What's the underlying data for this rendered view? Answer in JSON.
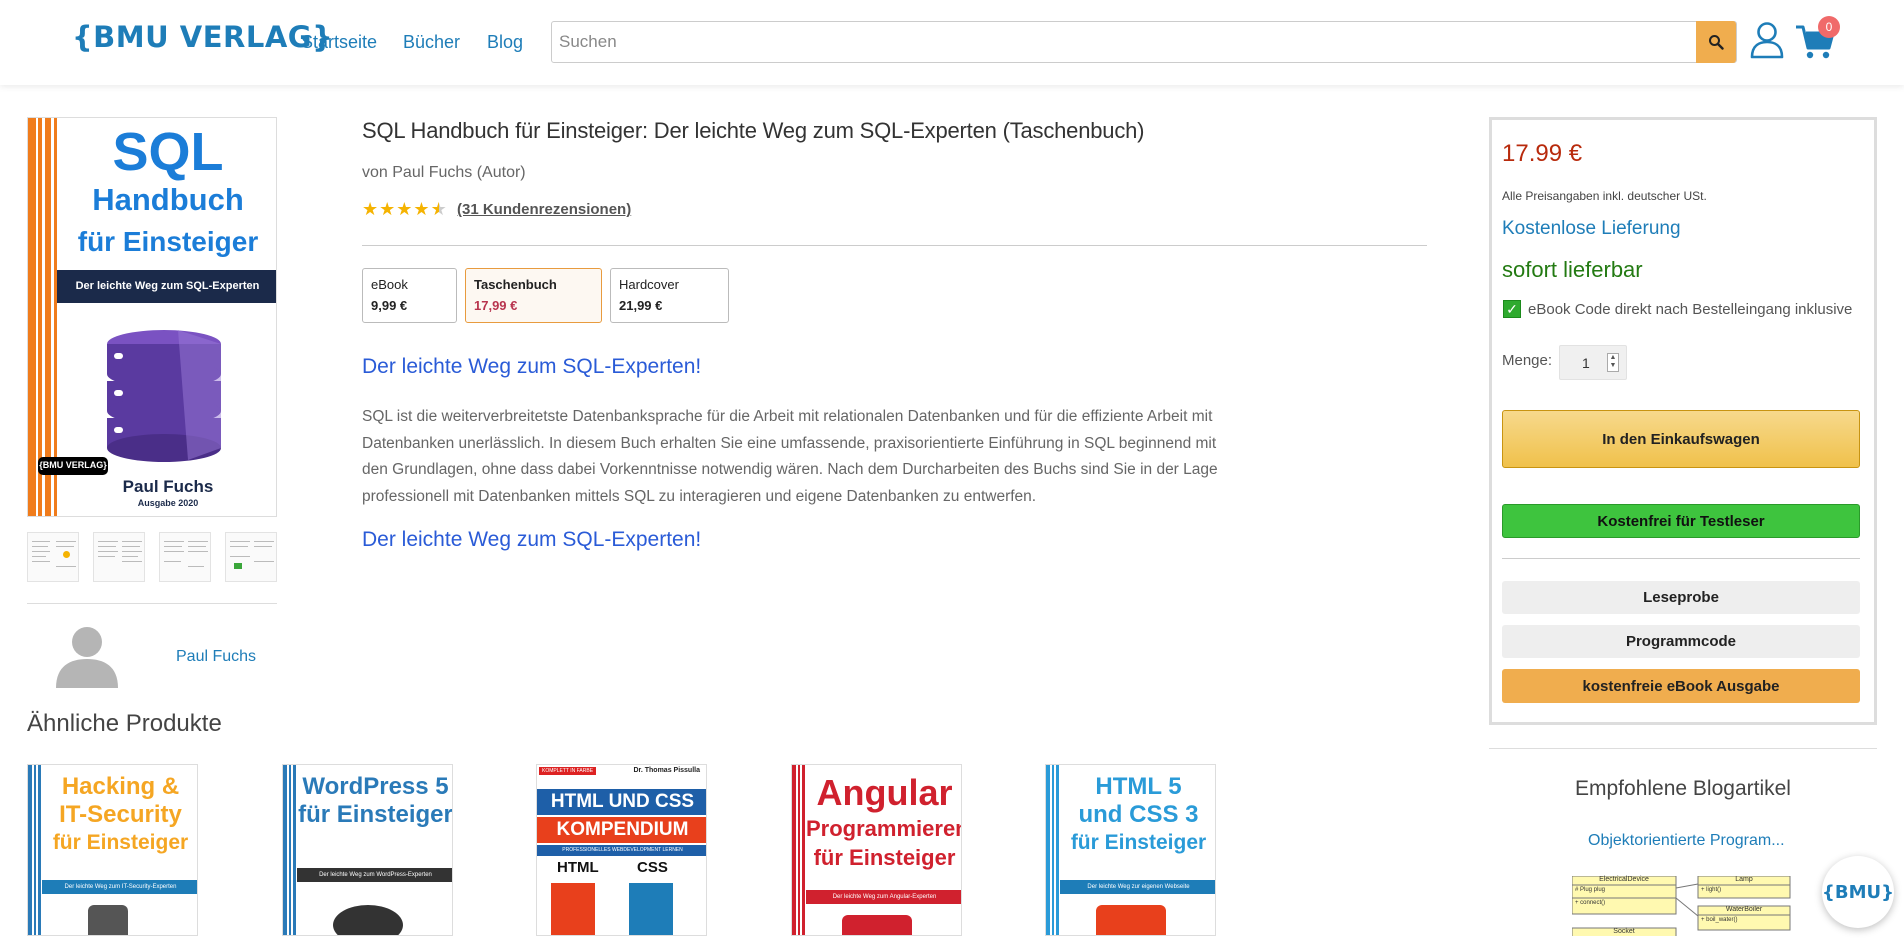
{
  "header": {
    "logo": "{BMU VERLAG}",
    "nav": [
      "Startseite",
      "Bücher",
      "Blog"
    ],
    "search_placeholder": "Suchen",
    "cart_count": "0"
  },
  "cover": {
    "title1": "SQL",
    "title2": "Handbuch",
    "title3": "für Einsteiger",
    "band": "Der leichte Weg zum SQL-Experten",
    "publisher": "{BMU VERLAG}",
    "author": "Paul Fuchs",
    "edition": "Ausgabe 2020"
  },
  "product": {
    "title": "SQL Handbuch für Einsteiger: Der leichte Weg zum SQL-Experten (Taschenbuch)",
    "byline": "von Paul Fuchs (Autor)",
    "rating": 4.5,
    "reviews": "(31 Kundenrezensionen)",
    "formats": [
      {
        "name": "eBook",
        "price": "9,99 €"
      },
      {
        "name": "Taschenbuch",
        "price": "17,99 €"
      },
      {
        "name": "Hardcover",
        "price": "21,99 €"
      }
    ],
    "subheading": "Der leichte Weg zum SQL-Experten!",
    "description": "SQL ist die weiterverbreitetste Datenbanksprache für die Arbeit mit relationalen Datenbanken und für die effiziente Arbeit mit Datenbanken unerlässlich. In diesem Buch erhalten Sie eine umfassende, praxisorientierte Einführung in SQL beginnend mit den Grundlagen, ohne dass dabei Vorkenntnisse notwendig wären. Nach dem Durcharbeiten des Buchs sind Sie in der Lage professionell mit Datenbanken mittels SQL zu interagieren und eigene Datenbanken zu entwerfen.",
    "subheading2": "Der leichte Weg zum SQL-Experten!"
  },
  "author": {
    "name": "Paul Fuchs"
  },
  "similar": {
    "title": "Ähnliche Produkte",
    "books": [
      {
        "line1": "Hacking &",
        "line2": "IT-Security",
        "line3": "für Einsteiger",
        "band": "Der leichte Weg zum IT-Security-Experten",
        "color": "#f5a623",
        "stripe": "#2a7ab8"
      },
      {
        "line1": "WordPress 5",
        "line2": "für Einsteiger",
        "line3": "",
        "band": "Der leichte Weg zum WordPress-Experten",
        "color": "#2a7ab8",
        "stripe": "#2a7ab8"
      },
      {
        "line1": "HTML UND CSS",
        "line2": "KOMPENDIUM",
        "line3": "",
        "band": "PROFESSIONELLES WEBDEVELOPMENT LERNEN",
        "color": "#1e5fa8",
        "stripe": "#e8401c",
        "top_left": "KOMPLETT IN FARBE",
        "top_right": "Dr. Thomas Pissulla",
        "tag1": "HTML",
        "tag2": "CSS"
      },
      {
        "line1": "Angular",
        "line2": "Programmieren",
        "line3": "für Einsteiger",
        "band": "Der leichte Weg zum Angular-Experten",
        "color": "#d0212e",
        "stripe": "#d0212e"
      },
      {
        "line1": "HTML 5",
        "line2": "und CSS 3",
        "line3": "für Einsteiger",
        "band": "Der leichte Weg zur eigenen Webseite",
        "color": "#2a9bd8",
        "stripe": "#2a9bd8"
      }
    ]
  },
  "buybox": {
    "price": "17.99 €",
    "vat": "Alle Preisangaben inkl. deutscher USt.",
    "shipping": "Kostenlose Lieferung",
    "stock": "sofort lieferbar",
    "ebook_code": "eBook Code direkt nach Bestelleingang inklusive",
    "qty_label": "Menge:",
    "qty": "1",
    "add_to_cart": "In den Einkaufswagen",
    "test_reader": "Kostenfrei für Testleser",
    "sample": "Leseprobe",
    "code": "Programmcode",
    "free_ebook": "kostenfreie eBook Ausgabe"
  },
  "blog": {
    "title": "Empfohlene Blogartikel",
    "link": "Objektorientierte Program...",
    "uml": [
      "ElectricalDevice",
      "# Plug plug",
      "+ connect()",
      "Lamp",
      "+ light()",
      "WaterBoiler",
      "+ boil_water()",
      "Socket"
    ]
  },
  "badge": "{BMU}",
  "colors": {
    "brand": "#1e7db8",
    "accent": "#f0ad4e",
    "price": "#b82a0c",
    "stock": "#237a12"
  }
}
